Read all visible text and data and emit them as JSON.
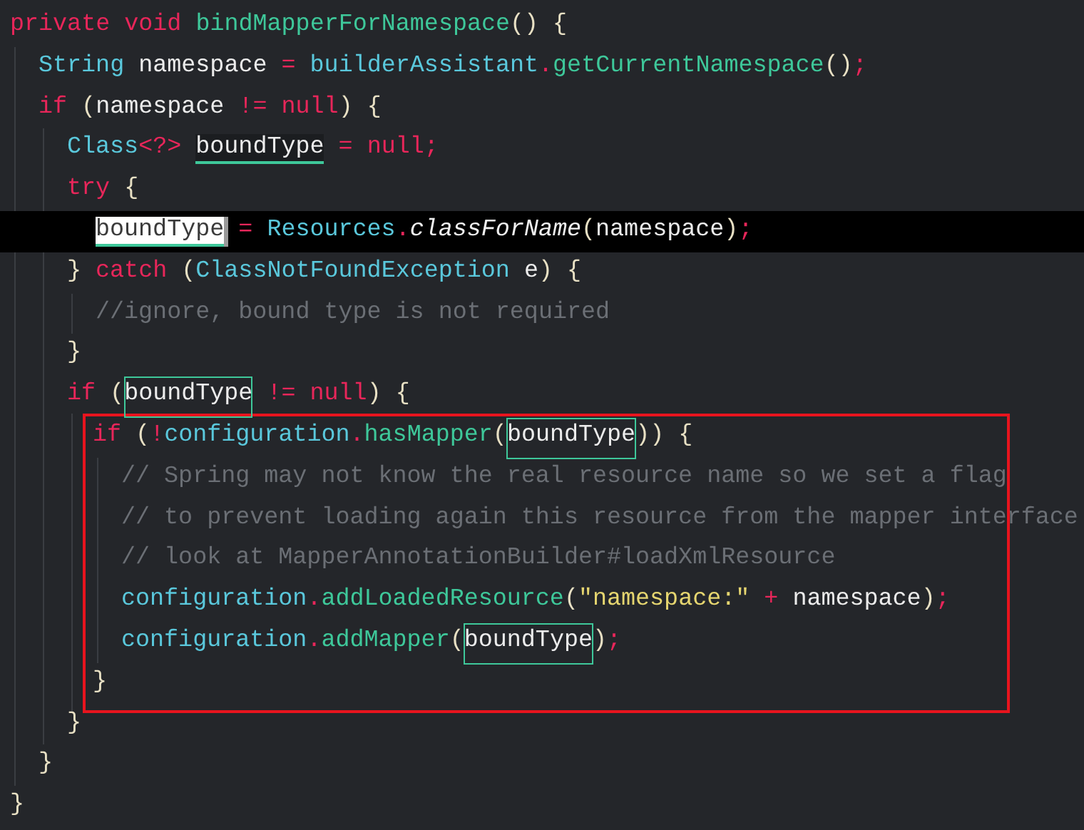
{
  "code": [
    {
      "tokens": [
        {
          "kind": "keyword",
          "text": "private "
        },
        {
          "kind": "keyword",
          "text": "void "
        },
        {
          "kind": "method",
          "text": "bindMapperForNamespace"
        },
        {
          "kind": "paren",
          "text": "() {"
        }
      ],
      "children": [
        {
          "tokens": [
            {
              "kind": "type",
              "text": "String "
            },
            {
              "kind": "plain",
              "text": "namespace "
            },
            {
              "kind": "operator",
              "text": "= "
            },
            {
              "kind": "type",
              "text": "builderAssistant"
            },
            {
              "kind": "operator",
              "text": "."
            },
            {
              "kind": "method",
              "text": "getCurrentNamespace"
            },
            {
              "kind": "paren",
              "text": "()"
            },
            {
              "kind": "operator",
              "text": ";"
            }
          ]
        },
        {
          "tokens": [
            {
              "kind": "keyword",
              "text": "if "
            },
            {
              "kind": "paren",
              "text": "("
            },
            {
              "kind": "plain",
              "text": "namespace "
            },
            {
              "kind": "operator",
              "text": "!= "
            },
            {
              "kind": "keyword",
              "text": "null"
            },
            {
              "kind": "paren",
              "text": ") {"
            }
          ],
          "children": [
            {
              "tokens": [
                {
                  "kind": "type",
                  "text": "Class"
                },
                {
                  "kind": "operator",
                  "text": "<?> "
                },
                {
                  "kind": "plain",
                  "text": "boundType",
                  "underlined": true
                },
                {
                  "kind": "operator",
                  "text": " = "
                },
                {
                  "kind": "keyword",
                  "text": "null"
                },
                {
                  "kind": "operator",
                  "text": ";"
                }
              ]
            },
            {
              "tokens": [
                {
                  "kind": "keyword",
                  "text": "try "
                },
                {
                  "kind": "paren",
                  "text": "{"
                }
              ],
              "children": [
                {
                  "current": true,
                  "tokens": [
                    {
                      "kind": "plain",
                      "text": "boundType",
                      "underlined": true,
                      "selected": true
                    },
                    {
                      "kind": "operator",
                      "text": " = "
                    },
                    {
                      "kind": "type",
                      "text": "Resources"
                    },
                    {
                      "kind": "operator",
                      "text": "."
                    },
                    {
                      "kind": "static",
                      "text": "classForName"
                    },
                    {
                      "kind": "paren",
                      "text": "("
                    },
                    {
                      "kind": "plain",
                      "text": "namespace"
                    },
                    {
                      "kind": "paren",
                      "text": ")"
                    },
                    {
                      "kind": "operator",
                      "text": ";"
                    }
                  ]
                }
              ]
            },
            {
              "tokens": [
                {
                  "kind": "paren",
                  "text": "} "
                },
                {
                  "kind": "keyword",
                  "text": "catch "
                },
                {
                  "kind": "paren",
                  "text": "("
                },
                {
                  "kind": "type",
                  "text": "ClassNotFoundException"
                },
                {
                  "kind": "plain",
                  "text": " e"
                },
                {
                  "kind": "paren",
                  "text": ") {"
                }
              ],
              "children": [
                {
                  "tokens": [
                    {
                      "kind": "comment",
                      "text": "//ignore, bound type is not required"
                    }
                  ]
                }
              ],
              "close": [
                {
                  "kind": "paren",
                  "text": "}"
                }
              ]
            },
            {
              "tokens": [
                {
                  "kind": "keyword",
                  "text": "if "
                },
                {
                  "kind": "paren",
                  "text": "("
                },
                {
                  "kind": "plain",
                  "text": "boundType",
                  "boxed": true
                },
                {
                  "kind": "operator",
                  "text": " != "
                },
                {
                  "kind": "keyword",
                  "text": "null"
                },
                {
                  "kind": "paren",
                  "text": ") {"
                }
              ],
              "children": [
                {
                  "annotated": true,
                  "tokens": [
                    {
                      "kind": "keyword",
                      "text": "if "
                    },
                    {
                      "kind": "paren",
                      "text": "("
                    },
                    {
                      "kind": "operator",
                      "text": "!"
                    },
                    {
                      "kind": "type",
                      "text": "configuration"
                    },
                    {
                      "kind": "operator",
                      "text": "."
                    },
                    {
                      "kind": "method",
                      "text": "hasMapper"
                    },
                    {
                      "kind": "paren",
                      "text": "("
                    },
                    {
                      "kind": "plain",
                      "text": "boundType",
                      "boxed": true
                    },
                    {
                      "kind": "paren",
                      "text": ")) {"
                    }
                  ],
                  "children": [
                    {
                      "tokens": [
                        {
                          "kind": "comment",
                          "text": "// Spring may not know the real resource name so we set a flag"
                        }
                      ]
                    },
                    {
                      "tokens": [
                        {
                          "kind": "comment",
                          "text": "// to prevent loading again this resource from the mapper interface"
                        }
                      ]
                    },
                    {
                      "tokens": [
                        {
                          "kind": "comment",
                          "text": "// look at MapperAnnotationBuilder#loadXmlResource"
                        }
                      ]
                    },
                    {
                      "tokens": [
                        {
                          "kind": "type",
                          "text": "configuration"
                        },
                        {
                          "kind": "operator",
                          "text": "."
                        },
                        {
                          "kind": "method",
                          "text": "addLoadedResource"
                        },
                        {
                          "kind": "paren",
                          "text": "("
                        },
                        {
                          "kind": "string",
                          "text": "\"namespace:\""
                        },
                        {
                          "kind": "operator",
                          "text": " + "
                        },
                        {
                          "kind": "plain",
                          "text": "namespace"
                        },
                        {
                          "kind": "paren",
                          "text": ")"
                        },
                        {
                          "kind": "operator",
                          "text": ";"
                        }
                      ]
                    },
                    {
                      "tokens": [
                        {
                          "kind": "type",
                          "text": "configuration"
                        },
                        {
                          "kind": "operator",
                          "text": "."
                        },
                        {
                          "kind": "method",
                          "text": "addMapper"
                        },
                        {
                          "kind": "paren",
                          "text": "("
                        },
                        {
                          "kind": "plain",
                          "text": "boundType",
                          "boxed": true
                        },
                        {
                          "kind": "paren",
                          "text": ")"
                        },
                        {
                          "kind": "operator",
                          "text": ";"
                        }
                      ]
                    }
                  ],
                  "close": [
                    {
                      "kind": "paren",
                      "text": "}"
                    }
                  ]
                }
              ],
              "close": [
                {
                  "kind": "paren",
                  "text": "}"
                }
              ]
            }
          ],
          "close": [
            {
              "kind": "paren",
              "text": "}"
            }
          ]
        }
      ],
      "close": [
        {
          "kind": "paren",
          "text": "}"
        }
      ]
    }
  ]
}
